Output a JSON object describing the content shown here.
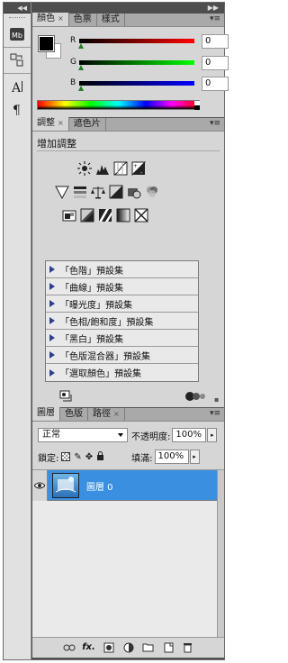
{
  "color_panel": {
    "tabs": [
      "顏色",
      "色票",
      "樣式"
    ],
    "fg_color": "#000000",
    "bg_color": "#ffffff",
    "channels": [
      {
        "label": "R",
        "value": "0",
        "gradient": "linear-gradient(to right,#000,#ff0000)"
      },
      {
        "label": "G",
        "value": "0",
        "gradient": "linear-gradient(to right,#000,#00ff00)"
      },
      {
        "label": "B",
        "value": "0",
        "gradient": "linear-gradient(to right,#000,#0000ff)"
      }
    ]
  },
  "adjustments": {
    "tabs": [
      "調整",
      "遮色片"
    ],
    "title": "增加調整",
    "row1_icons": [
      "brightness-contrast-icon",
      "levels-icon",
      "curves-icon",
      "exposure-icon"
    ],
    "row2_icons": [
      "vibrance-icon",
      "hue-saturation-icon",
      "color-balance-icon",
      "black-white-icon",
      "photo-filter-icon",
      "channel-mixer-icon"
    ],
    "row3_icons": [
      "invert-icon",
      "posterize-icon",
      "threshold-icon",
      "gradient-map-icon",
      "selective-color-icon"
    ],
    "presets": [
      "「色階」預設集",
      "「曲線」預設集",
      "「曝光度」預設集",
      "「色相/飽和度」預設集",
      "「黑白」預設集",
      "「色版混合器」預設集",
      "「選取顏色」預設集"
    ]
  },
  "layers": {
    "tabs": [
      "圖層",
      "色版",
      "路徑"
    ],
    "blend_mode": "正常",
    "opacity_label": "不透明度:",
    "opacity_value": "100%",
    "lock_label": "鎖定:",
    "fill_label": "填滿:",
    "fill_value": "100%",
    "items": [
      {
        "name": "圖層 0",
        "selected": true,
        "visible": true
      }
    ],
    "accent": "#3a8fe0"
  }
}
